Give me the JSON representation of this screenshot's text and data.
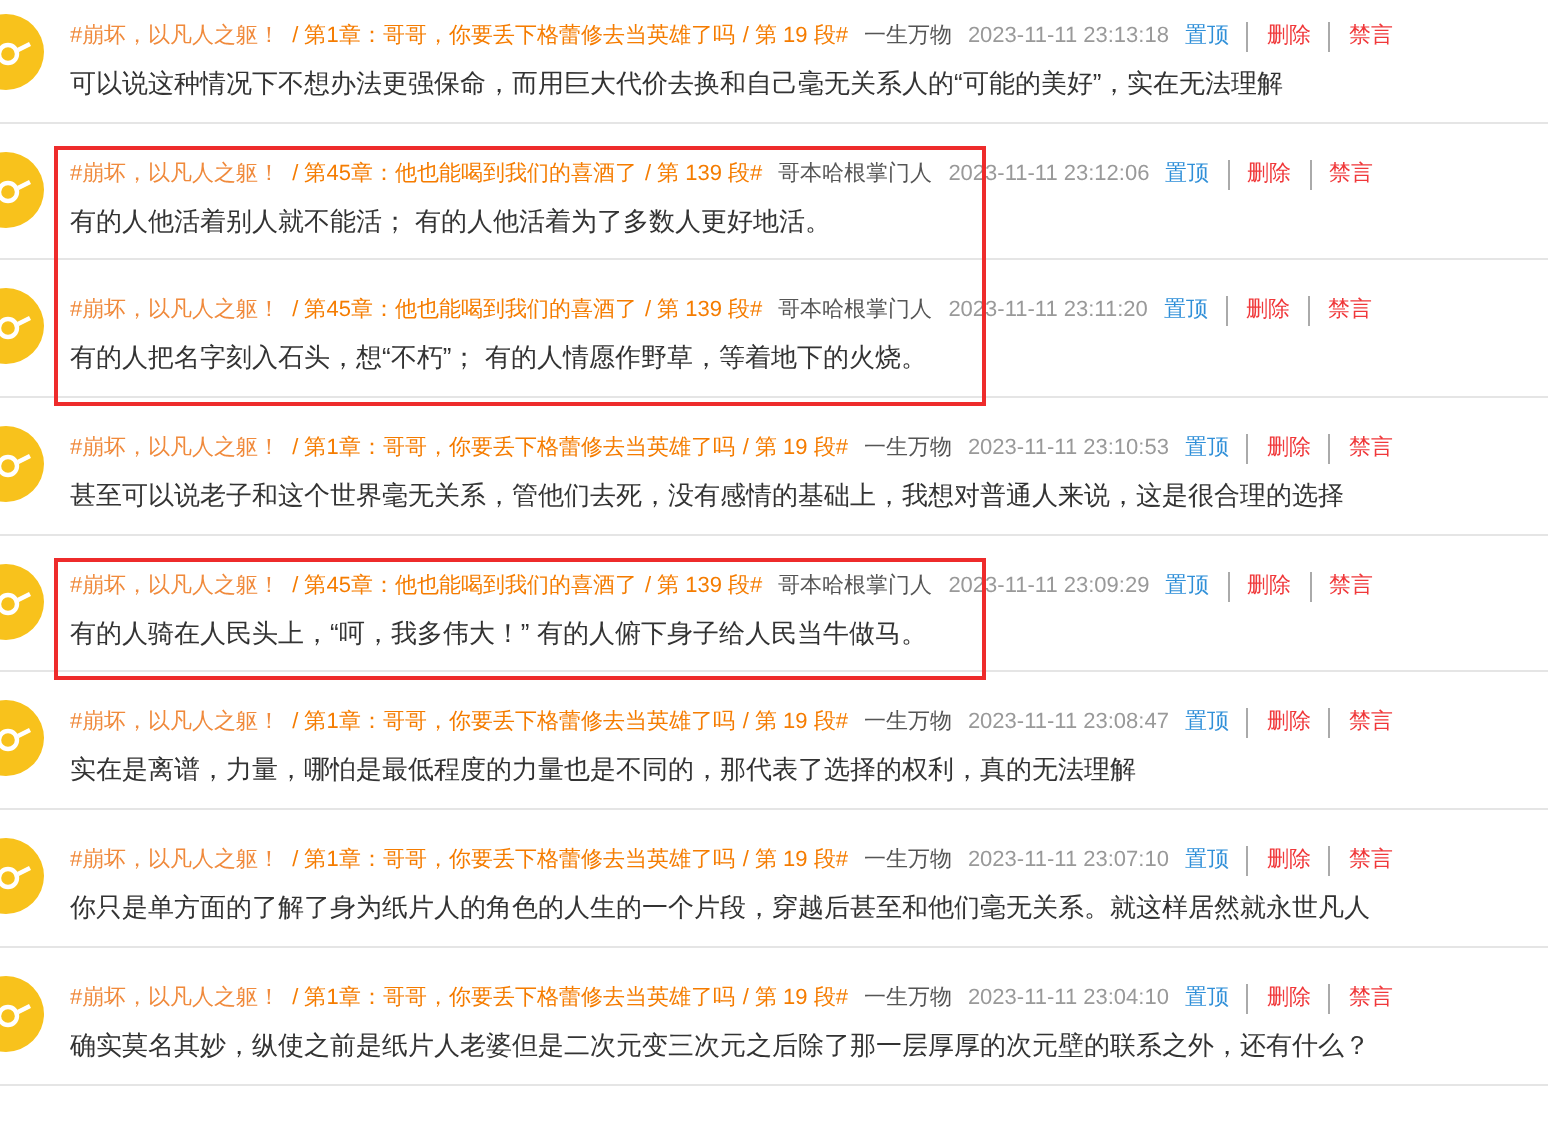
{
  "comments": [
    {
      "book": "#崩坏，以凡人之躯！",
      "chapter": "/ 第1章：哥哥，你要丢下格蕾修去当英雄了吗",
      "paragraph": "/ 第 19 段#",
      "user": "一生万物",
      "time": "2023-11-11 23:13:18",
      "text": "可以说这种情况下不想办法更强保命，而用巨大代价去换和自己毫无关系人的“可能的美好”，实在无法理解",
      "highlighted": false,
      "actions": [
        {
          "label": "置顶",
          "kind": "pin"
        },
        {
          "label": "删除",
          "kind": "delete"
        },
        {
          "label": "禁言",
          "kind": "mute"
        }
      ]
    },
    {
      "book": "#崩坏，以凡人之躯！",
      "chapter": "/ 第45章：他也能喝到我们的喜酒了",
      "paragraph": "/ 第 139 段#",
      "user": "哥本哈根掌门人",
      "time": "2023-11-11 23:12:06",
      "text": "有的人他活着别人就不能活； 有的人他活着为了多数人更好地活。",
      "highlighted": true,
      "actions": [
        {
          "label": "置顶",
          "kind": "pin"
        },
        {
          "label": "删除",
          "kind": "delete"
        },
        {
          "label": "禁言",
          "kind": "mute"
        }
      ]
    },
    {
      "book": "#崩坏，以凡人之躯！",
      "chapter": "/ 第45章：他也能喝到我们的喜酒了",
      "paragraph": "/ 第 139 段#",
      "user": "哥本哈根掌门人",
      "time": "2023-11-11 23:11:20",
      "text": "有的人把名字刻入石头，想“不朽”； 有的人情愿作野草，等着地下的火烧。",
      "highlighted": true,
      "actions": [
        {
          "label": "置顶",
          "kind": "pin"
        },
        {
          "label": "删除",
          "kind": "delete"
        },
        {
          "label": "禁言",
          "kind": "mute"
        }
      ]
    },
    {
      "book": "#崩坏，以凡人之躯！",
      "chapter": "/ 第1章：哥哥，你要丢下格蕾修去当英雄了吗",
      "paragraph": "/ 第 19 段#",
      "user": "一生万物",
      "time": "2023-11-11 23:10:53",
      "text": "甚至可以说老子和这个世界毫无关系，管他们去死，没有感情的基础上，我想对普通人来说，这是很合理的选择",
      "highlighted": false,
      "actions": [
        {
          "label": "置顶",
          "kind": "pin"
        },
        {
          "label": "删除",
          "kind": "delete"
        },
        {
          "label": "禁言",
          "kind": "mute"
        }
      ]
    },
    {
      "book": "#崩坏，以凡人之躯！",
      "chapter": "/ 第45章：他也能喝到我们的喜酒了",
      "paragraph": "/ 第 139 段#",
      "user": "哥本哈根掌门人",
      "time": "2023-11-11 23:09:29",
      "text": "有的人骑在人民头上，“呵，我多伟大！” 有的人俯下身子给人民当牛做马。",
      "highlighted": true,
      "actions": [
        {
          "label": "置顶",
          "kind": "pin"
        },
        {
          "label": "删除",
          "kind": "delete"
        },
        {
          "label": "禁言",
          "kind": "mute"
        }
      ]
    },
    {
      "book": "#崩坏，以凡人之躯！",
      "chapter": "/ 第1章：哥哥，你要丢下格蕾修去当英雄了吗",
      "paragraph": "/ 第 19 段#",
      "user": "一生万物",
      "time": "2023-11-11 23:08:47",
      "text": "实在是离谱，力量，哪怕是最低程度的力量也是不同的，那代表了选择的权利，真的无法理解",
      "highlighted": false,
      "actions": [
        {
          "label": "置顶",
          "kind": "pin"
        },
        {
          "label": "删除",
          "kind": "delete"
        },
        {
          "label": "禁言",
          "kind": "mute"
        }
      ]
    },
    {
      "book": "#崩坏，以凡人之躯！",
      "chapter": "/ 第1章：哥哥，你要丢下格蕾修去当英雄了吗",
      "paragraph": "/ 第 19 段#",
      "user": "一生万物",
      "time": "2023-11-11 23:07:10",
      "text": "你只是单方面的了解了身为纸片人的角色的人生的一个片段，穿越后甚至和他们毫无关系。就这样居然就永世凡人",
      "highlighted": false,
      "actions": [
        {
          "label": "置顶",
          "kind": "pin"
        },
        {
          "label": "删除",
          "kind": "delete"
        },
        {
          "label": "禁言",
          "kind": "mute"
        }
      ]
    },
    {
      "book": "#崩坏，以凡人之躯！",
      "chapter": "/ 第1章：哥哥，你要丢下格蕾修去当英雄了吗",
      "paragraph": "/ 第 19 段#",
      "user": "一生万物",
      "time": "2023-11-11 23:04:10",
      "text": "确实莫名其妙，纵使之前是纸片人老婆但是二次元变三次元之后除了那一层厚厚的次元壁的联系之外，还有什么？",
      "highlighted": false,
      "actions": [
        {
          "label": "置顶",
          "kind": "pin"
        },
        {
          "label": "删除",
          "kind": "delete"
        },
        {
          "label": "禁言",
          "kind": "mute"
        }
      ]
    }
  ]
}
